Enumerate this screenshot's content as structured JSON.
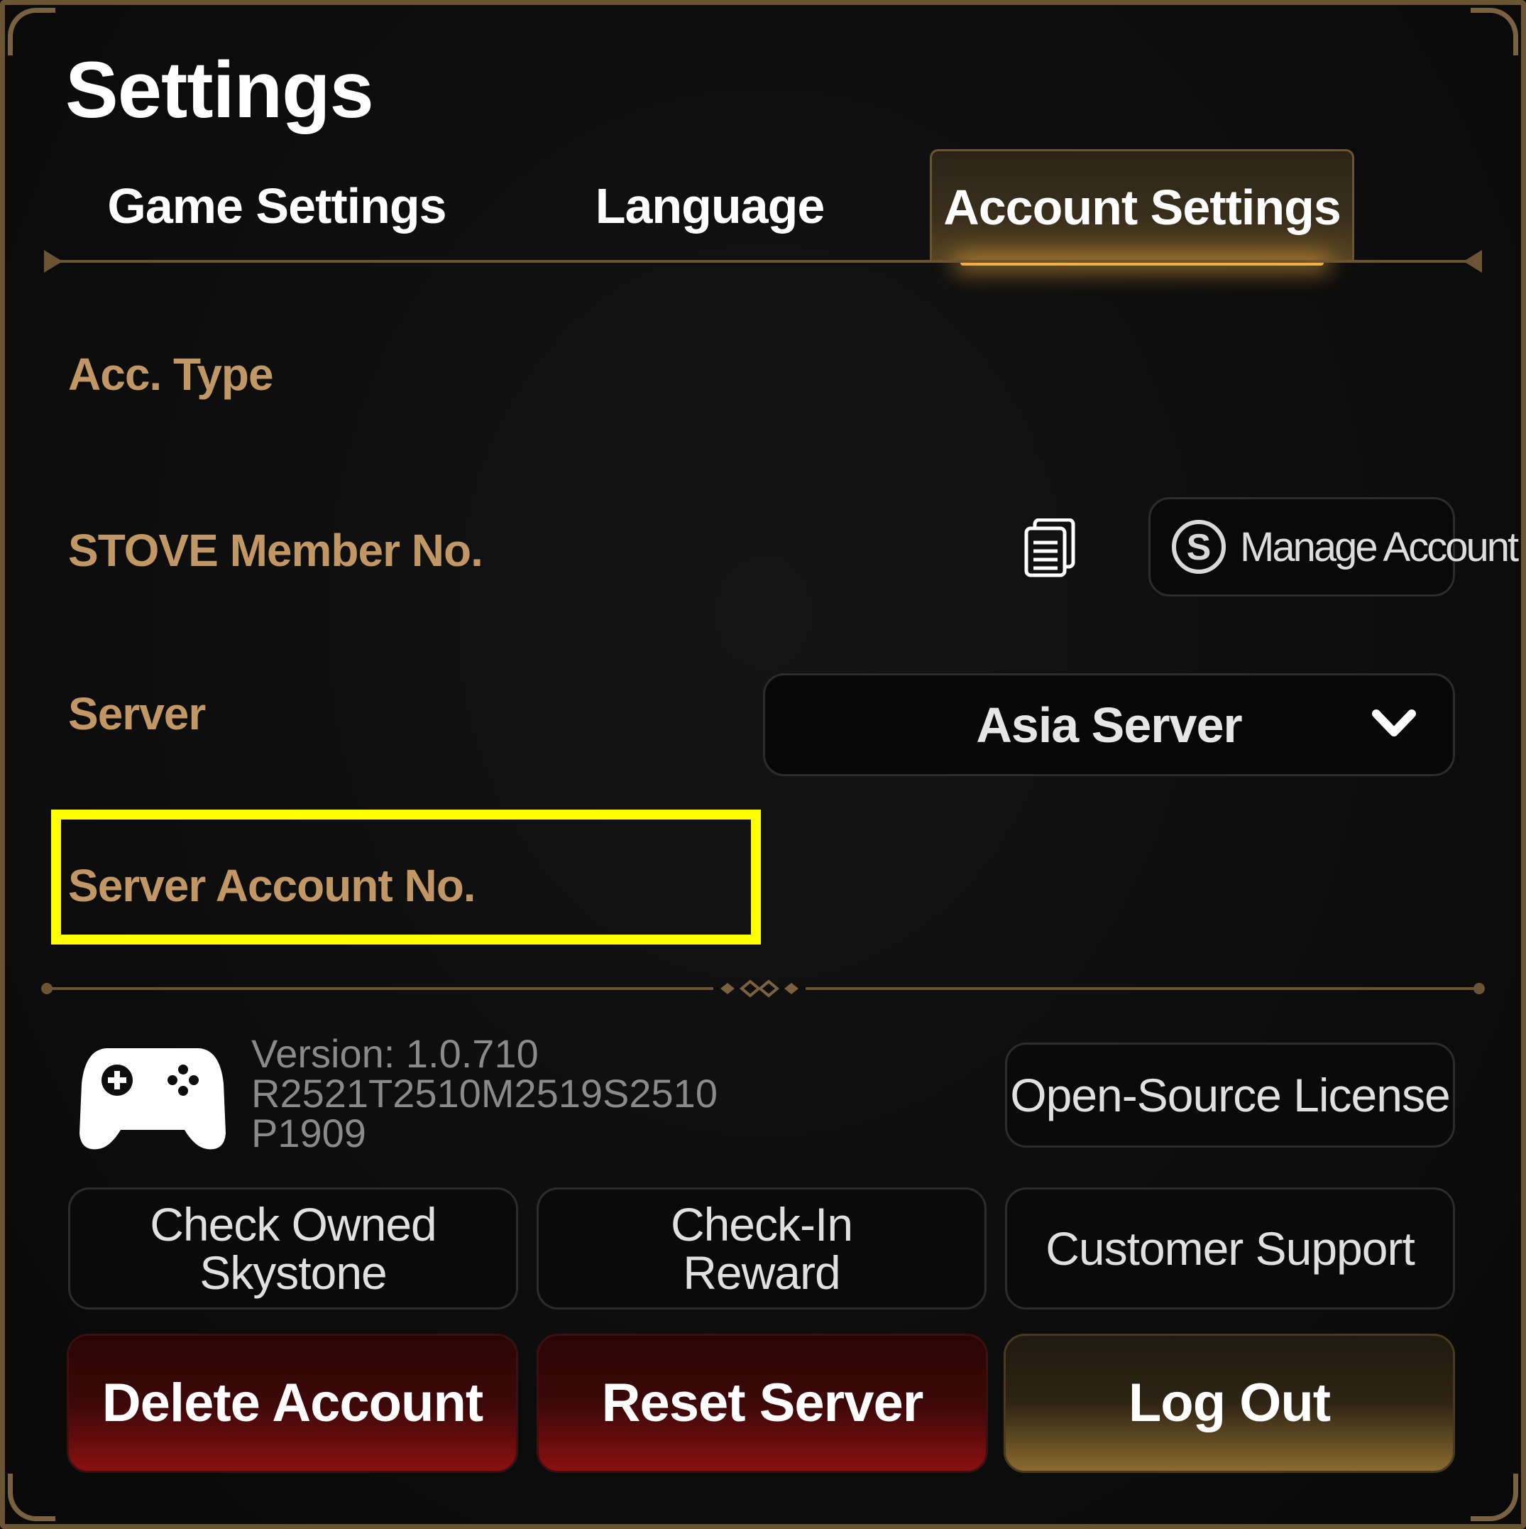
{
  "page": {
    "title": "Settings"
  },
  "tabs": [
    {
      "label": "Game Settings",
      "active": false
    },
    {
      "label": "Language",
      "active": false
    },
    {
      "label": "Account Settings",
      "active": true
    }
  ],
  "account": {
    "acc_type_label": "Acc. Type",
    "stove_member_label": "STOVE Member No.",
    "manage_account_label": "Manage Account",
    "server_label": "Server",
    "server_value": "Asia Server",
    "server_account_label": "Server Account No."
  },
  "info": {
    "version_line1": "Version: 1.0.710",
    "version_line2": "R2521T2510M2519S2510",
    "version_line3": "P1909"
  },
  "buttons": {
    "open_source": "Open-Source License",
    "check_skystone_l1": "Check Owned",
    "check_skystone_l2": "Skystone",
    "checkin_l1": "Check-In",
    "checkin_l2": "Reward",
    "customer_support": "Customer Support",
    "delete_account": "Delete Account",
    "reset_server": "Reset Server",
    "log_out": "Log Out"
  },
  "icons": {
    "copy": "copy-icon",
    "stove": "stove-s-icon",
    "dropdown": "chevron-down-icon",
    "gamepad": "gamepad-icon"
  },
  "colors": {
    "label_gold": "#c29766",
    "frame_border": "#6b5434",
    "highlight": "#ffff00",
    "danger": "#8a1010",
    "accent_gold": "#f0b040"
  }
}
